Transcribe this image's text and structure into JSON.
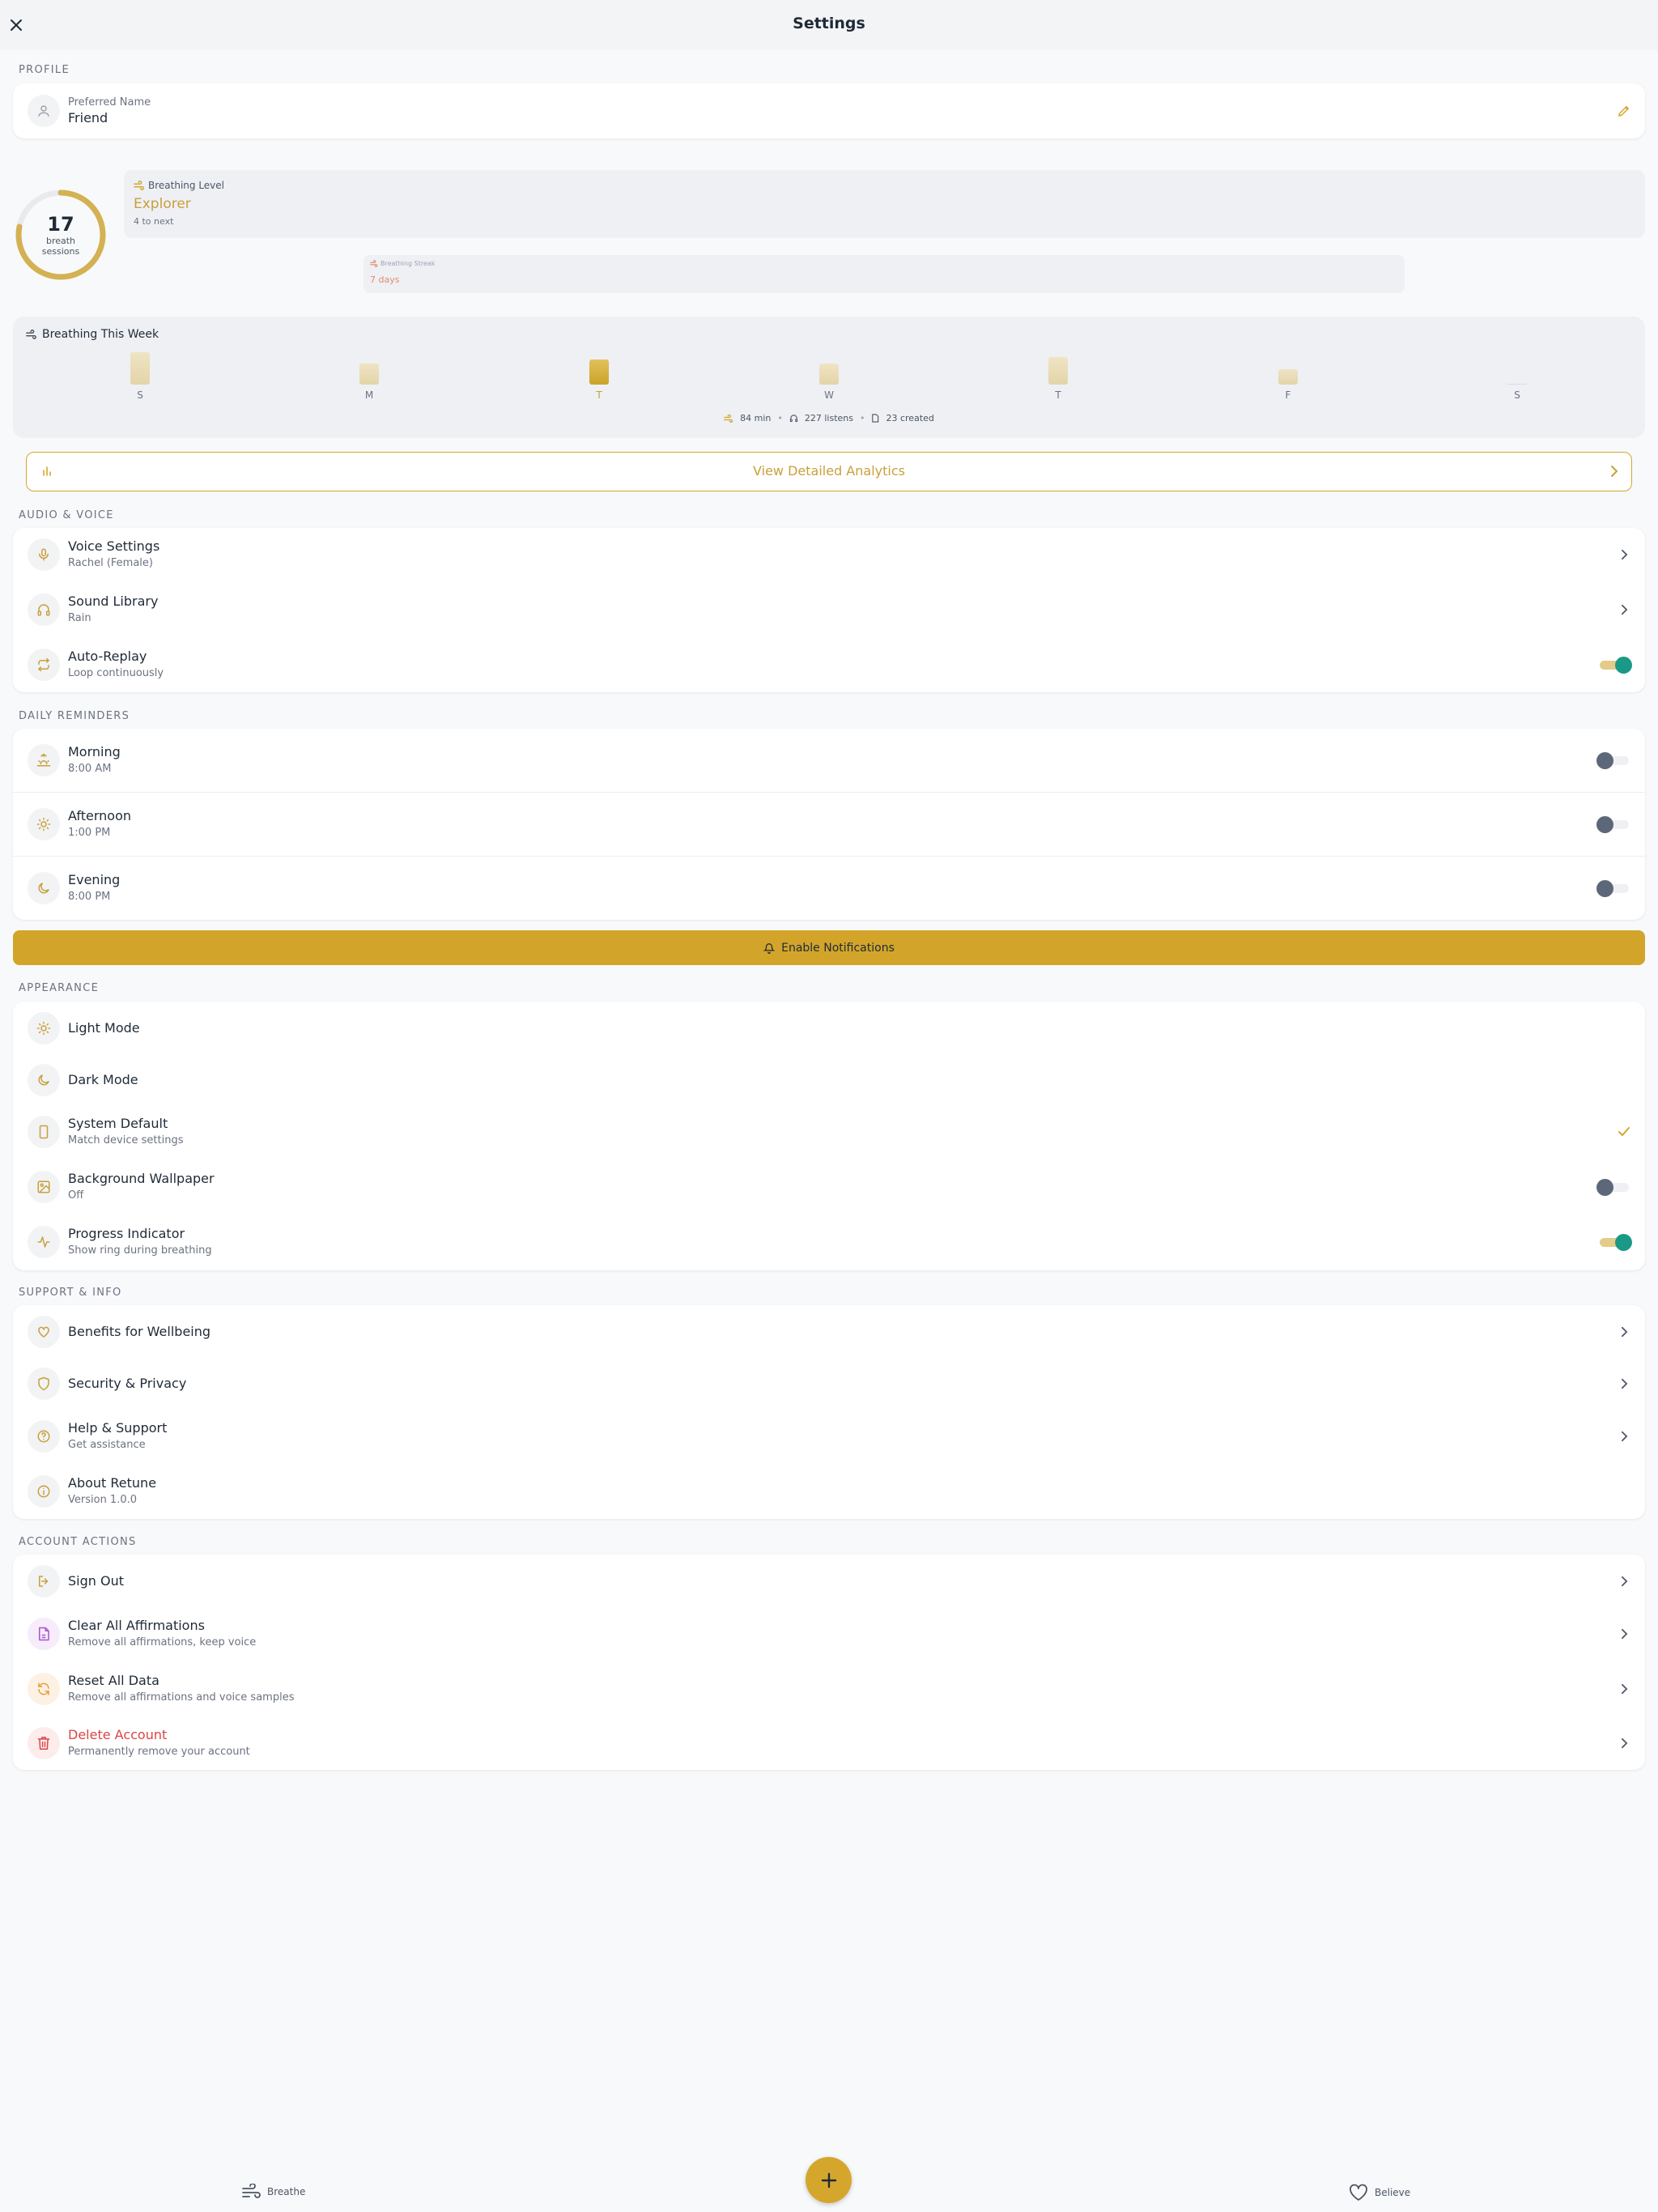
{
  "header": {
    "title": "Settings"
  },
  "sections": {
    "profile": "PROFILE",
    "audio": "AUDIO & VOICE",
    "reminders": "DAILY REMINDERS",
    "appearance": "APPEARANCE",
    "support": "SUPPORT & INFO",
    "account": "ACCOUNT ACTIONS"
  },
  "profile": {
    "label": "Preferred Name",
    "value": "Friend"
  },
  "stats": {
    "sessions": "17",
    "sessions_label_1": "breath",
    "sessions_label_2": "sessions",
    "level_label": "Breathing Level",
    "level_value": "Explorer",
    "level_next": "4 to next",
    "streak_label": "Breathing Streak",
    "streak_value": "7 days"
  },
  "week": {
    "title": "Breathing This Week",
    "days": [
      "S",
      "M",
      "T",
      "W",
      "T",
      "F",
      "S"
    ],
    "minutes": [
      28,
      18,
      22,
      18,
      24,
      13,
      1
    ],
    "highlight_day": 2,
    "summary_minutes": "84 min",
    "summary_listens": "227 listens",
    "summary_created": "23 created"
  },
  "analytics": {
    "label": "View Detailed Analytics"
  },
  "audio": {
    "voice_title": "Voice Settings",
    "voice_sub": "Rachel (Female)",
    "sound_title": "Sound Library",
    "sound_sub": "Rain",
    "replay_title": "Auto-Replay",
    "replay_sub": "Loop continuously",
    "replay_on": true
  },
  "reminders": {
    "morning_title": "Morning",
    "morning_time": "8:00 AM",
    "afternoon_title": "Afternoon",
    "afternoon_time": "1:00 PM",
    "evening_title": "Evening",
    "evening_time": "8:00 PM",
    "enable_label": "Enable Notifications"
  },
  "appearance": {
    "light": "Light Mode",
    "dark": "Dark Mode",
    "system_title": "System Default",
    "system_sub": "Match device settings",
    "wallpaper_title": "Background Wallpaper",
    "wallpaper_sub": "Off",
    "progress_title": "Progress Indicator",
    "progress_sub": "Show ring during breathing"
  },
  "support": {
    "benefits": "Benefits for Wellbeing",
    "security": "Security & Privacy",
    "help_title": "Help & Support",
    "help_sub": "Get assistance",
    "about_title": "About Retune",
    "about_sub": "Version 1.0.0"
  },
  "account": {
    "signout": "Sign Out",
    "clear_title": "Clear All Affirmations",
    "clear_sub": "Remove all affirmations, keep voice",
    "reset_title": "Reset All Data",
    "reset_sub": "Remove all affirmations and voice samples",
    "delete_title": "Delete Account",
    "delete_sub": "Permanently remove your account"
  },
  "nav": {
    "breathe": "Breathe",
    "believe": "Believe"
  },
  "colors": {
    "accent": "#d4a72c",
    "toggle_on": "#1a9a86",
    "danger": "#dc4444"
  }
}
